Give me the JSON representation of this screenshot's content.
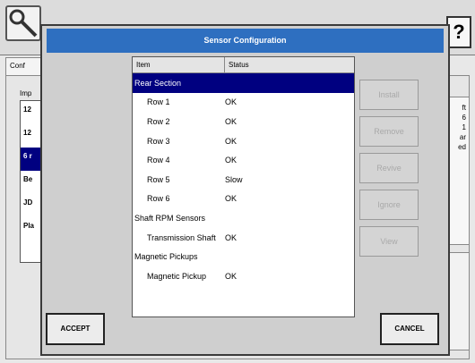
{
  "background": {
    "help_label": "?",
    "tab_label": "Conf",
    "imp_label": "Imp",
    "list_items": [
      "12",
      "12",
      "6 r",
      "Be",
      "JD",
      "Pla"
    ],
    "right_values": [
      "ft",
      "6",
      "1",
      "ar",
      "ed"
    ]
  },
  "dialog": {
    "title": "Sensor Configuration",
    "columns": {
      "item": "Item",
      "status": "Status"
    },
    "rows": [
      {
        "item": "Rear Section",
        "status": ""
      },
      {
        "item": "Row 1",
        "status": "OK"
      },
      {
        "item": "Row 2",
        "status": "OK"
      },
      {
        "item": "Row 3",
        "status": "OK"
      },
      {
        "item": "Row 4",
        "status": "OK"
      },
      {
        "item": "Row 5",
        "status": "Slow"
      },
      {
        "item": "Row 6",
        "status": "OK"
      },
      {
        "item": "Shaft RPM Sensors",
        "status": ""
      },
      {
        "item": "Transmission Shaft",
        "status": "OK"
      },
      {
        "item": "Magnetic Pickups",
        "status": ""
      },
      {
        "item": "Magnetic Pickup",
        "status": "OK"
      }
    ],
    "side_buttons": {
      "install": "Install",
      "remove": "Remove",
      "revive": "Revive",
      "ignore": "Ignore",
      "view": "View"
    },
    "accept_label": "ACCEPT",
    "cancel_label": "CANCEL"
  },
  "colors": {
    "title_bar": "#2e6fc0",
    "selection": "#000080",
    "dialog_bg": "#cfcfcf",
    "disabled_text": "#a9a9a9"
  }
}
